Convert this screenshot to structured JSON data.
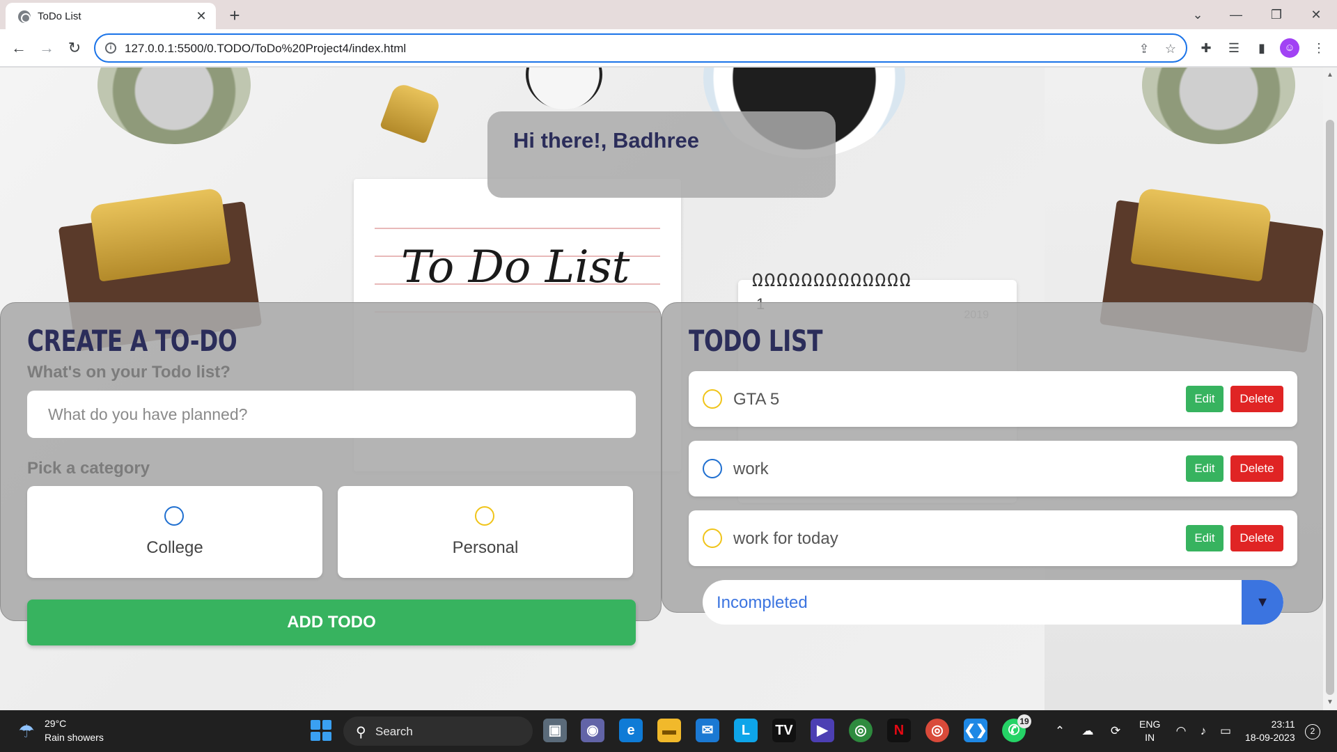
{
  "browser": {
    "tab_title": "ToDo List",
    "tab_close": "✕",
    "new_tab": "+",
    "url": "127.0.0.1:5500/0.TODO/ToDo%20Project4/index.html",
    "window_controls": [
      "⌄",
      "—",
      "❐",
      "✕"
    ],
    "icons": [
      "back-icon",
      "forward-icon",
      "reload-icon",
      "info-icon",
      "share-icon",
      "star-icon",
      "extensions-icon",
      "media-icon",
      "sidebar-icon",
      "menu-icon"
    ]
  },
  "scene": {
    "notebook_title": "To Do List",
    "calendar_year": "2019",
    "calendar_day": "1"
  },
  "greeting": "Hi there!, Badhree",
  "create": {
    "heading": "CREATE A TO-DO",
    "question": "What's on your Todo list?",
    "placeholder": "What do you have planned?",
    "category_label": "Pick a category",
    "categories": [
      {
        "label": "College",
        "color": "#1f6fd0"
      },
      {
        "label": "Personal",
        "color": "#f0c419"
      }
    ],
    "add_button": "ADD TODO"
  },
  "todo_list": {
    "heading": "TODO LIST",
    "items": [
      {
        "text": "GTA 5",
        "category_color": "#f0c419",
        "edit": "Edit",
        "delete": "Delete"
      },
      {
        "text": "work",
        "category_color": "#1f6fd0",
        "edit": "Edit",
        "delete": "Delete"
      },
      {
        "text": "work for today",
        "category_color": "#f0c419",
        "edit": "Edit",
        "delete": "Delete"
      }
    ],
    "filter_value": "Incompleted",
    "filter_arrow": "▼"
  },
  "taskbar": {
    "weather_temp": "29°C",
    "weather_desc": "Rain showers",
    "search": "Search",
    "whatsapp_badge": "19",
    "lang_1": "ENG",
    "lang_2": "IN",
    "time": "23:11",
    "date": "18-09-2023",
    "notifications": "2"
  },
  "colors": {
    "accent_green": "#37b35f",
    "danger_red": "#e02424",
    "heading_navy": "#2b2d5a",
    "filter_blue": "#3b74e0"
  }
}
